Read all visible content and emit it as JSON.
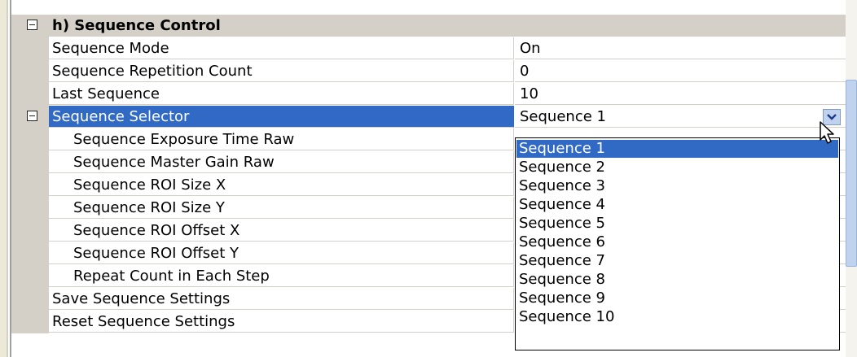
{
  "category": {
    "label": "h) Sequence Control"
  },
  "rows": [
    {
      "name": "Sequence Mode",
      "value": "On"
    },
    {
      "name": "Sequence Repetition Count",
      "value": "0"
    },
    {
      "name": "Last Sequence",
      "value": "10"
    },
    {
      "name": "Sequence Selector",
      "value": "Sequence 1"
    },
    {
      "name": "Sequence Exposure Time Raw",
      "value": ""
    },
    {
      "name": "Sequence Master Gain Raw",
      "value": ""
    },
    {
      "name": "Sequence ROI Size X",
      "value": ""
    },
    {
      "name": "Sequence ROI Size Y",
      "value": ""
    },
    {
      "name": "Sequence ROI Offset X",
      "value": ""
    },
    {
      "name": "Sequence ROI Offset Y",
      "value": ""
    },
    {
      "name": "Repeat Count in Each Step",
      "value": ""
    },
    {
      "name": "Save Sequence Settings",
      "value": ""
    },
    {
      "name": "Reset Sequence Settings",
      "value": ""
    }
  ],
  "dropdown": {
    "selected": "Sequence 1",
    "options": [
      "Sequence 1",
      "Sequence 2",
      "Sequence 3",
      "Sequence 4",
      "Sequence 5",
      "Sequence 6",
      "Sequence 7",
      "Sequence 8",
      "Sequence 9",
      "Sequence 10"
    ]
  },
  "colors": {
    "selection": "#316ac5",
    "gutter": "#d4d0c8"
  },
  "icons": {
    "expander": "collapse-icon",
    "combo": "chevron-down-icon",
    "cursor": "mouse-pointer-icon"
  }
}
